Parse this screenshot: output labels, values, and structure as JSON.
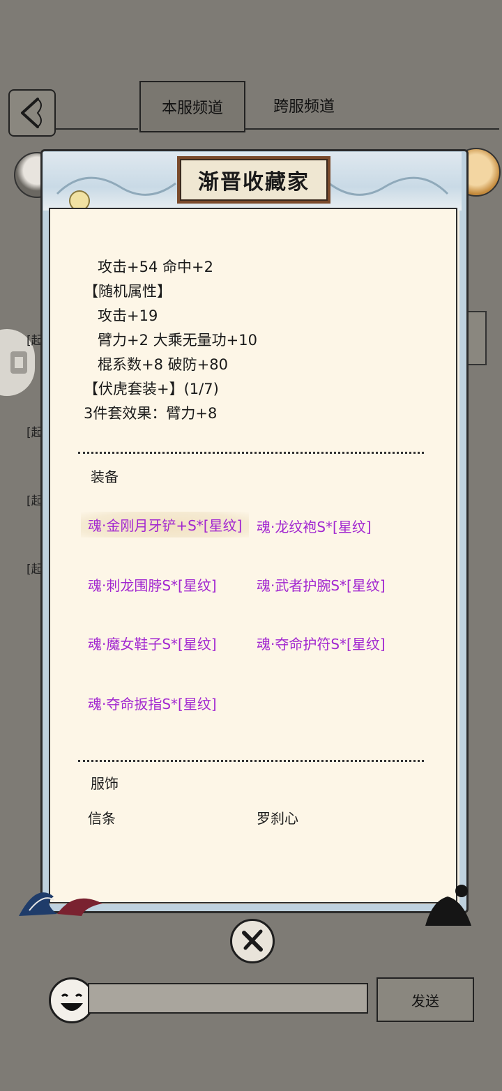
{
  "header": {
    "tabs": [
      {
        "label": "本服频道",
        "active": true
      },
      {
        "label": "跨服频道",
        "active": false
      }
    ]
  },
  "side_snippets": [
    "[起",
    "[起",
    "[起",
    "[起"
  ],
  "modal": {
    "title": "渐晋收藏家",
    "stats_lines": [
      "攻击+54 命中+2",
      "【随机属性】",
      "攻击+19",
      "臂力+2 大乘无量功+10",
      "棍系数+8 破防+80",
      "【伏虎套装+】(1/7)",
      "3件套效果：臂力+8"
    ],
    "equipment_label": "装备",
    "equipment": [
      "魂·金刚月牙铲+S*[星纹]",
      "魂·龙纹袍S*[星纹]",
      "魂·刺龙围脖S*[星纹]",
      "魂·武者护腕S*[星纹]",
      "魂·魔女鞋子S*[星纹]",
      "魂·夺命护符S*[星纹]",
      "魂·夺命扳指S*[星纹]"
    ],
    "clothing_label": "服饰",
    "clothing": [
      "信条",
      "罗刹心"
    ]
  },
  "chat": {
    "input_value": "",
    "send_label": "发送"
  },
  "colors": {
    "background": "#7e7b75",
    "panel": "#fdf6e7",
    "equipment_text": "#a227d0",
    "frame_accent": "#bfd2df"
  },
  "icons": [
    "back-arrow-icon",
    "close-x-icon",
    "smiley-emoji-icon"
  ]
}
